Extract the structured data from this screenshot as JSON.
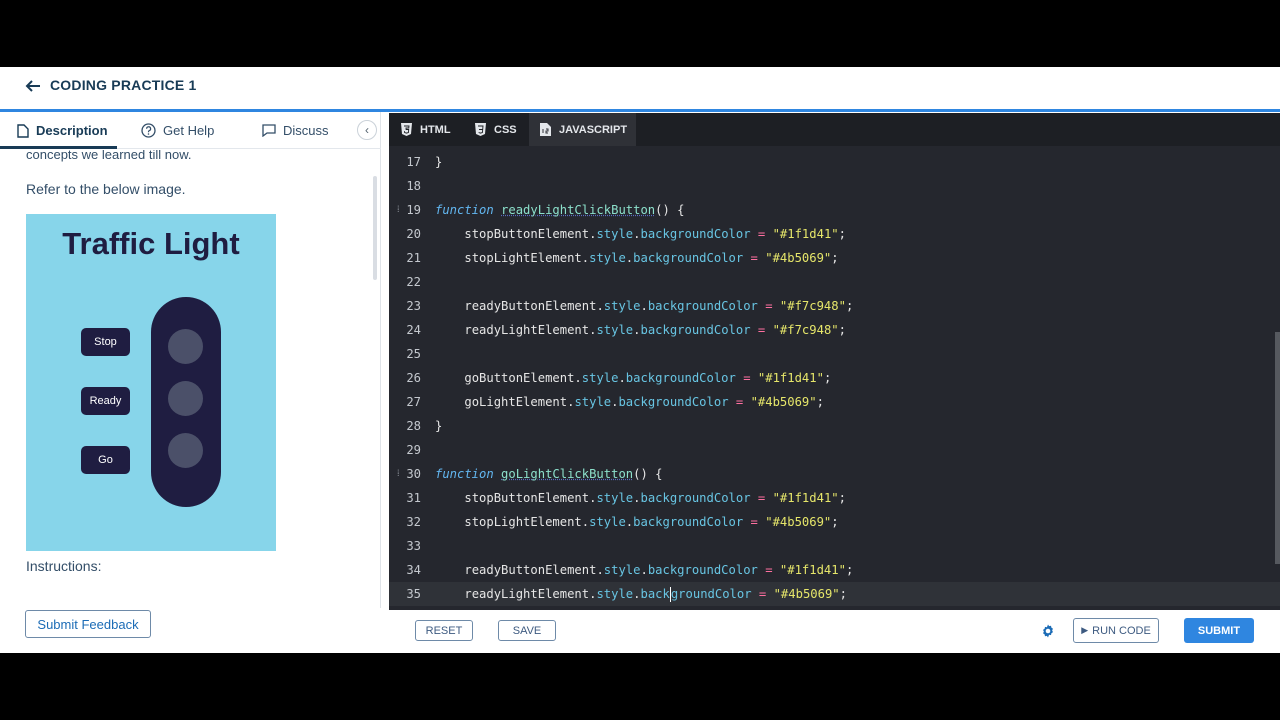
{
  "header": {
    "title": "CODING PRACTICE 1"
  },
  "left_tabs": [
    {
      "label": "Description",
      "icon": "document-icon",
      "active": true
    },
    {
      "label": "Get Help",
      "icon": "help-circle-icon"
    },
    {
      "label": "Discuss",
      "icon": "chat-icon"
    }
  ],
  "description": {
    "cut_text": "concepts we learned till now.",
    "refer": "Refer to the below image.",
    "instructions": "Instructions:"
  },
  "preview": {
    "title": "Traffic Light",
    "buttons": [
      "Stop",
      "Ready",
      "Go"
    ],
    "colors": {
      "bg": "#87d5ea",
      "button": "#1f1d41",
      "light": "#4b5069"
    }
  },
  "feedback_label": "Submit Feedback",
  "editor_tabs": [
    {
      "label": "HTML",
      "icon": "html5-icon"
    },
    {
      "label": "CSS",
      "icon": "css3-icon"
    },
    {
      "label": "JAVASCRIPT",
      "icon": "js-file-icon",
      "active": true
    }
  ],
  "code_lines": [
    {
      "n": "17",
      "text": "}"
    },
    {
      "n": "18",
      "text": ""
    },
    {
      "n": "19",
      "text": "function readyLightClickButton() {"
    },
    {
      "n": "20",
      "text": "    stopButtonElement.style.backgroundColor = \"#1f1d41\";"
    },
    {
      "n": "21",
      "text": "    stopLightElement.style.backgroundColor = \"#4b5069\";"
    },
    {
      "n": "22",
      "text": ""
    },
    {
      "n": "23",
      "text": "    readyButtonElement.style.backgroundColor = \"#f7c948\";"
    },
    {
      "n": "24",
      "text": "    readyLightElement.style.backgroundColor = \"#f7c948\";"
    },
    {
      "n": "25",
      "text": ""
    },
    {
      "n": "26",
      "text": "    goButtonElement.style.backgroundColor = \"#1f1d41\";"
    },
    {
      "n": "27",
      "text": "    goLightElement.style.backgroundColor = \"#4b5069\";"
    },
    {
      "n": "28",
      "text": "}"
    },
    {
      "n": "29",
      "text": ""
    },
    {
      "n": "30",
      "text": "function goLightClickButton() {"
    },
    {
      "n": "31",
      "text": "    stopButtonElement.style.backgroundColor = \"#1f1d41\";"
    },
    {
      "n": "32",
      "text": "    stopLightElement.style.backgroundColor = \"#4b5069\";"
    },
    {
      "n": "33",
      "text": ""
    },
    {
      "n": "34",
      "text": "    readyButtonElement.style.backgroundColor = \"#1f1d41\";"
    },
    {
      "n": "35",
      "text": "    readyLightElement.style.backgroundColor = \"#4b5069\";"
    }
  ],
  "bottom": {
    "reset": "RESET",
    "save": "SAVE",
    "run": "RUN CODE",
    "submit": "SUBMIT"
  },
  "accent": "#2f86e0"
}
